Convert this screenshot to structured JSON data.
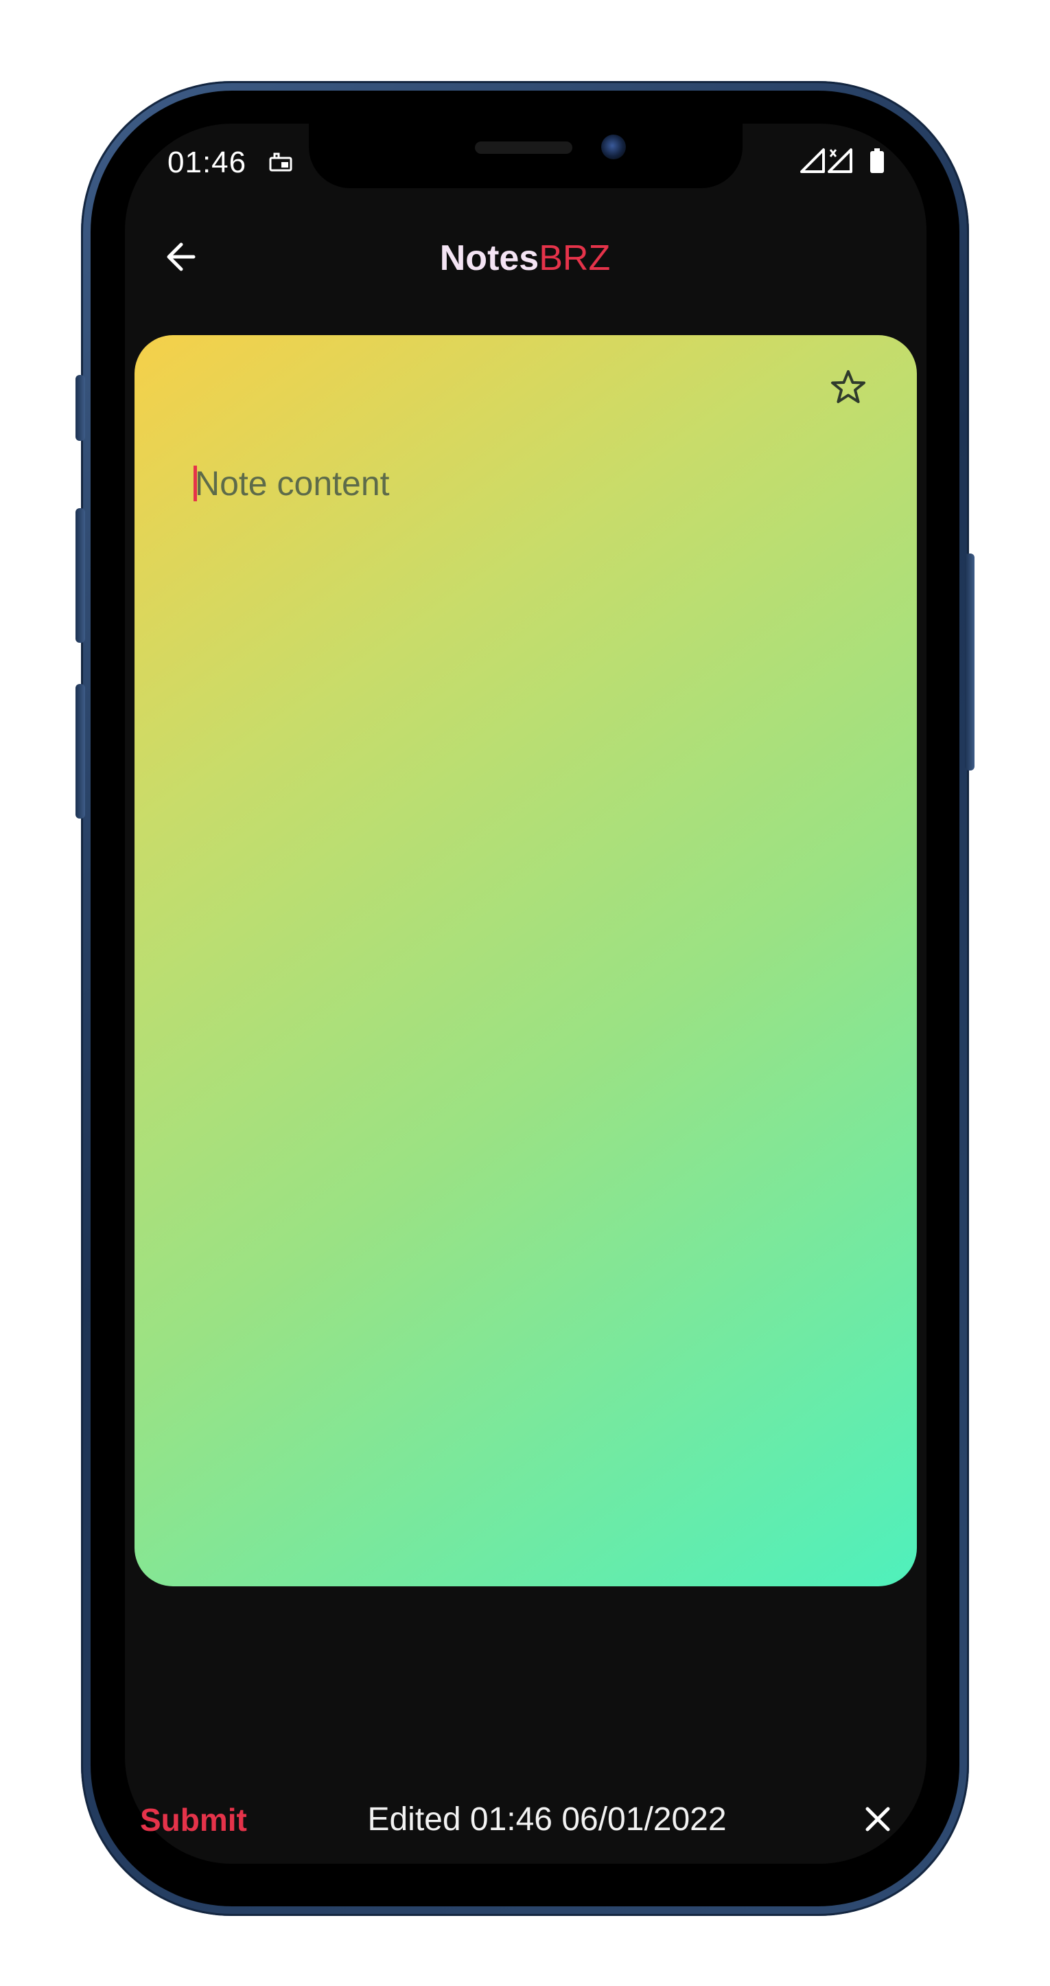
{
  "status_bar": {
    "time": "01:46",
    "left_icon": "notification-icon",
    "right_icons": [
      "signal-icon",
      "signal-no-data-icon",
      "battery-icon"
    ]
  },
  "app_bar": {
    "back_icon": "arrow-left-icon",
    "title_part1": "Notes",
    "title_part2": "BRZ",
    "title_part1_color": "#f4e4f4",
    "title_part2_color": "#e5334a"
  },
  "note": {
    "favorite_icon": "star-outline-icon",
    "content_value": "",
    "content_placeholder": "Note content",
    "gradient_start": "#f5d04a",
    "gradient_end": "#4ff0bc"
  },
  "bottom_bar": {
    "submit_label": "Submit",
    "edited_text": "Edited 01:46 06/01/2022",
    "close_icon": "close-icon",
    "accent_color": "#e5334a"
  }
}
